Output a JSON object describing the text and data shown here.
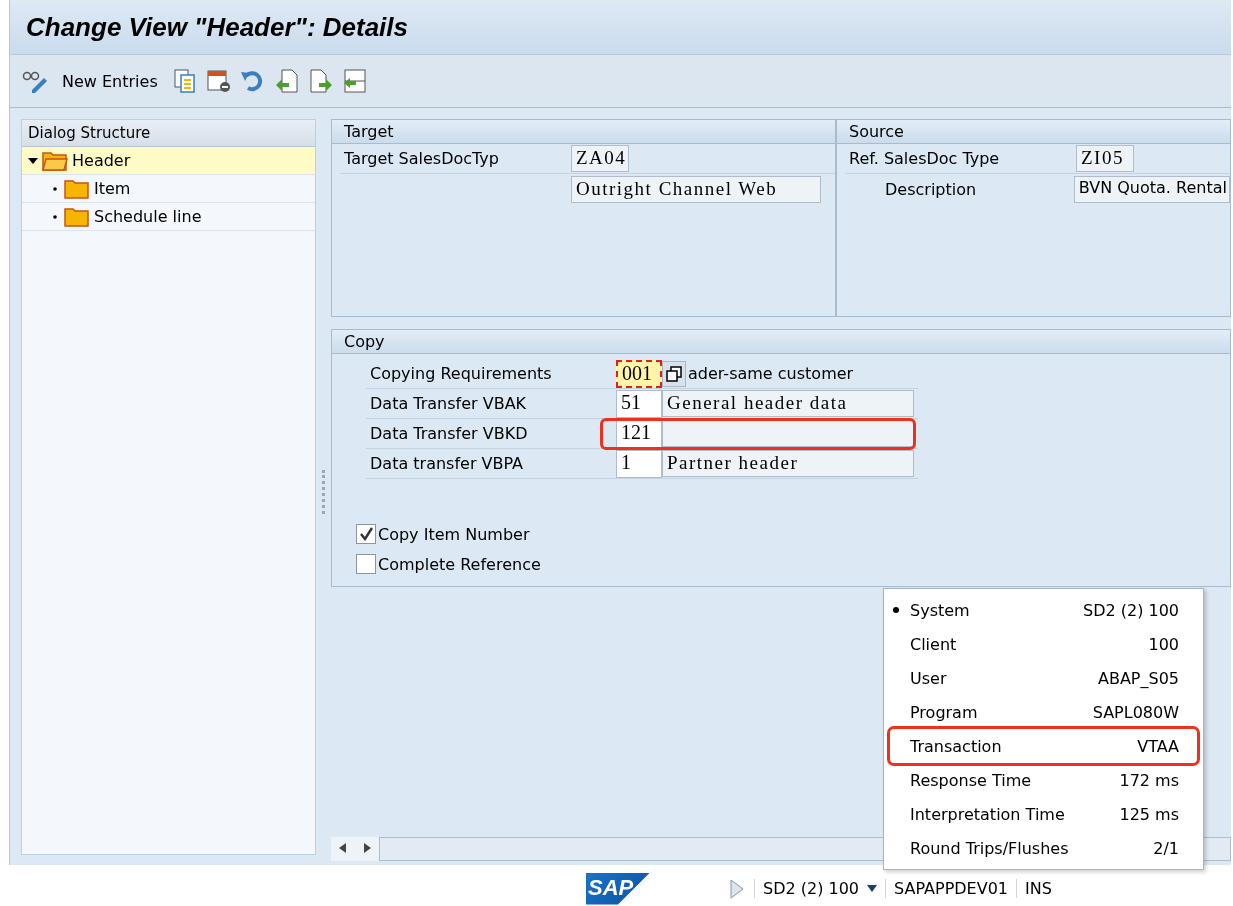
{
  "window": {
    "title": "Change View \"Header\": Details"
  },
  "toolbar": {
    "items": [
      {
        "kind": "glasses"
      },
      {
        "kind": "text",
        "label": "New Entries"
      },
      {
        "kind": "copy"
      },
      {
        "kind": "delete"
      },
      {
        "kind": "undo"
      },
      {
        "kind": "previous"
      },
      {
        "kind": "next"
      },
      {
        "kind": "select"
      }
    ]
  },
  "dialog_structure": {
    "title": "Dialog Structure",
    "items": [
      {
        "label": "Header",
        "selected": true,
        "expanded": true,
        "children": [
          {
            "label": "Item",
            "selected": false
          },
          {
            "label": "Schedule line",
            "selected": false
          }
        ]
      }
    ]
  },
  "target": {
    "title": "Target",
    "label": "Target SalesDocTyp",
    "value": "ZA04",
    "description": "Outright Channel Web"
  },
  "source": {
    "title": "Source",
    "label": "Ref. SalesDoc Type",
    "value": "ZI05",
    "description_label": "Description",
    "description": "BVN Quota. Rental"
  },
  "copy": {
    "title": "Copy",
    "rows": [
      {
        "label": "Copying Requirements",
        "value": "001",
        "description": "ader-same customer",
        "focused": true,
        "highlighted": false,
        "kind": "requirement"
      },
      {
        "label": "Data Transfer VBAK",
        "value": "51",
        "description": "General header data",
        "focused": false,
        "highlighted": false,
        "kind": "transfer"
      },
      {
        "label": "Data Transfer VBKD",
        "value": "121",
        "focused": false,
        "highlighted": true,
        "kind": "transfer"
      },
      {
        "label": "Data transfer VBPA",
        "value": "1",
        "description": "Partner header",
        "focused": false,
        "highlighted": false,
        "kind": "transfer"
      }
    ],
    "checkboxes": [
      {
        "label": "Copy Item Number",
        "checked": true
      },
      {
        "label": "Complete Reference",
        "checked": false
      }
    ]
  },
  "status_menu": {
    "items": [
      {
        "label": "System",
        "value": "SD2 (2) 100",
        "selected": true,
        "highlighted": false
      },
      {
        "label": "Client",
        "value": "100",
        "selected": false,
        "highlighted": false
      },
      {
        "label": "User",
        "value": "ABAP_S05",
        "selected": false,
        "highlighted": false
      },
      {
        "label": "Program",
        "value": "SAPL080W",
        "selected": false,
        "highlighted": false
      },
      {
        "label": "Transaction",
        "value": "VTAA",
        "selected": false,
        "highlighted": true
      },
      {
        "label": "Response Time",
        "value": "172 ms",
        "selected": false,
        "highlighted": false
      },
      {
        "label": "Interpretation Time",
        "value": "125 ms",
        "selected": false,
        "highlighted": false
      },
      {
        "label": "Round Trips/Flushes",
        "value": "2/1",
        "selected": false,
        "highlighted": false
      }
    ]
  },
  "status_bar": {
    "logo": "SAP",
    "system": "SD2 (2) 100",
    "server": "SAPAPPDEV01",
    "mode": "INS"
  }
}
